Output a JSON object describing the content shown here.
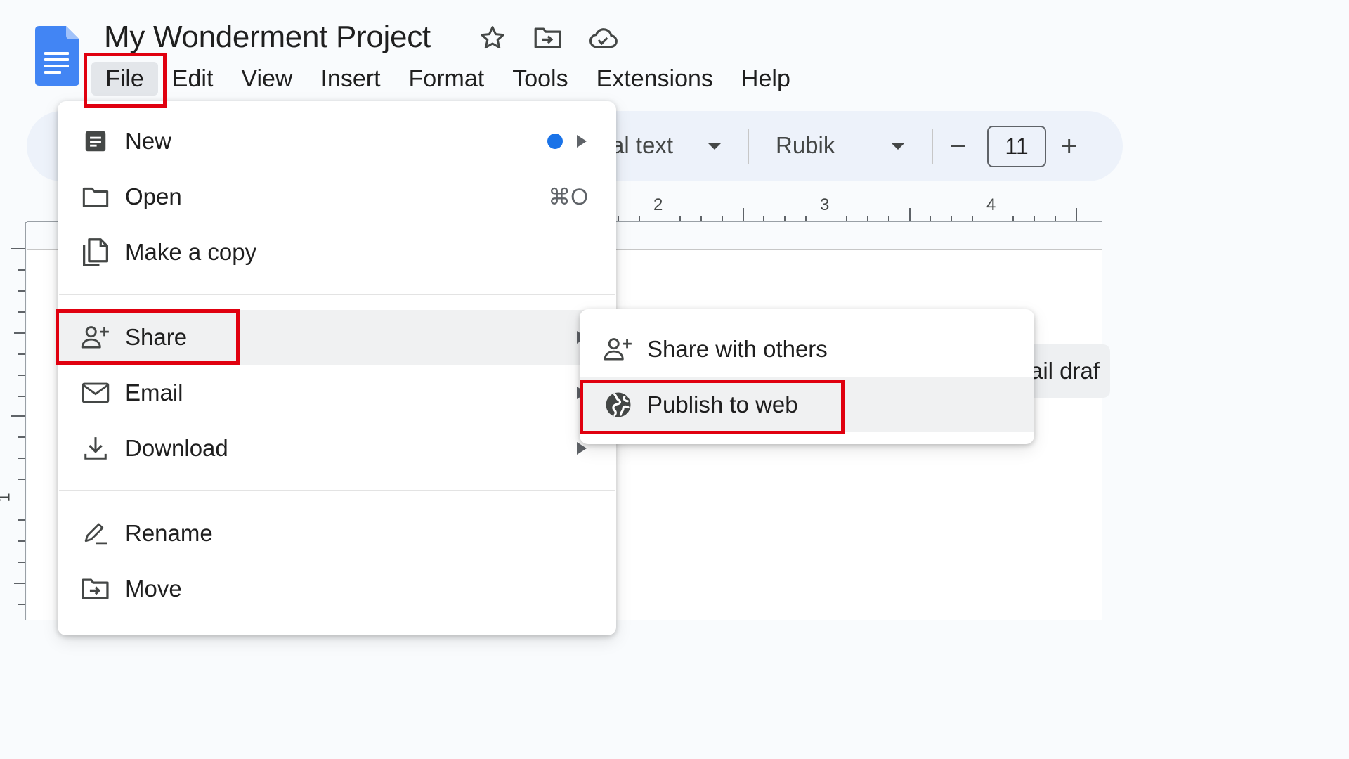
{
  "doc": {
    "title": "My Wonderment Project",
    "icons": {
      "logo": "google-docs-icon",
      "star": "star-icon",
      "move": "move-to-folder-icon",
      "status": "cloud-saved-icon"
    }
  },
  "menubar": {
    "items": [
      {
        "label": "File",
        "active": true
      },
      {
        "label": "Edit"
      },
      {
        "label": "View"
      },
      {
        "label": "Insert"
      },
      {
        "label": "Format"
      },
      {
        "label": "Tools"
      },
      {
        "label": "Extensions"
      },
      {
        "label": "Help"
      }
    ]
  },
  "toolbar": {
    "style_label": "al text",
    "font_label": "Rubik",
    "font_size": "11",
    "decrease_symbol": "−",
    "increase_symbol": "+"
  },
  "ruler": {
    "h_labels": [
      "2",
      "3",
      "4"
    ],
    "v_label": "1"
  },
  "page": {
    "visible_fragment": "ail draf"
  },
  "file_menu": {
    "items": [
      {
        "label": "New",
        "icon": "new-document-icon",
        "has_submenu": true,
        "badge": "blue-dot"
      },
      {
        "label": "Open",
        "icon": "folder-icon",
        "shortcut": "⌘O"
      },
      {
        "label": "Make a copy",
        "icon": "copy-icon"
      },
      {
        "label": "Share",
        "icon": "person-add-icon",
        "has_submenu": true,
        "hovered": true
      },
      {
        "label": "Email",
        "icon": "email-icon",
        "has_submenu": true
      },
      {
        "label": "Download",
        "icon": "download-icon",
        "has_submenu": true
      },
      {
        "label": "Rename",
        "icon": "rename-pencil-icon"
      },
      {
        "label": "Move",
        "icon": "move-to-folder-icon"
      }
    ]
  },
  "share_submenu": {
    "items": [
      {
        "label": "Share with others",
        "icon": "person-add-icon"
      },
      {
        "label": "Publish to web",
        "icon": "globe-icon",
        "hovered": true
      }
    ]
  },
  "colors": {
    "highlight": "#e0000f",
    "docs_blue": "#4285f4",
    "badge_blue": "#1a73e8"
  }
}
